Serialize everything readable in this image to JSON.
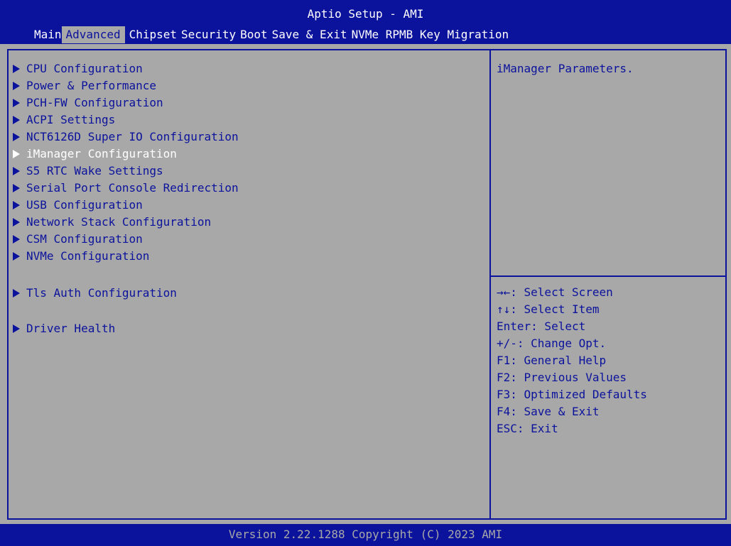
{
  "header": {
    "title": "Aptio Setup - AMI",
    "tabs": [
      {
        "label": "Main",
        "active": false
      },
      {
        "label": "Advanced",
        "active": true
      },
      {
        "label": "Chipset",
        "active": false
      },
      {
        "label": "Security",
        "active": false
      },
      {
        "label": "Boot",
        "active": false
      },
      {
        "label": "Save & Exit",
        "active": false
      },
      {
        "label": "NVMe RPMB Key Migration",
        "active": false
      }
    ]
  },
  "menu": {
    "items": [
      {
        "label": "CPU Configuration",
        "selected": false
      },
      {
        "label": "Power & Performance",
        "selected": false
      },
      {
        "label": "PCH-FW Configuration",
        "selected": false
      },
      {
        "label": "ACPI Settings",
        "selected": false
      },
      {
        "label": "NCT6126D Super IO Configuration",
        "selected": false
      },
      {
        "label": "iManager Configuration",
        "selected": true
      },
      {
        "label": "S5 RTC Wake Settings",
        "selected": false
      },
      {
        "label": "Serial Port Console Redirection",
        "selected": false
      },
      {
        "label": "USB Configuration",
        "selected": false
      },
      {
        "label": "Network Stack Configuration",
        "selected": false
      },
      {
        "label": "CSM Configuration",
        "selected": false
      },
      {
        "label": "NVMe Configuration",
        "selected": false
      },
      {
        "label": "Tls Auth Configuration",
        "selected": false
      },
      {
        "label": "Driver Health",
        "selected": false
      }
    ]
  },
  "help": {
    "description": "iManager Parameters.",
    "keys": [
      "→←: Select Screen",
      "↑↓: Select Item",
      "Enter: Select",
      "+/-: Change Opt.",
      "F1: General Help",
      "F2: Previous Values",
      "F3: Optimized Defaults",
      "F4: Save & Exit",
      "ESC: Exit"
    ]
  },
  "footer": {
    "text": "Version 2.22.1288 Copyright (C) 2023 AMI"
  },
  "colors": {
    "bios_blue": "#0b129c",
    "bios_gray": "#a8a8a8",
    "highlight_white": "#ffffff"
  },
  "icons": {
    "submenu_marker": "submenu-arrow-icon"
  }
}
